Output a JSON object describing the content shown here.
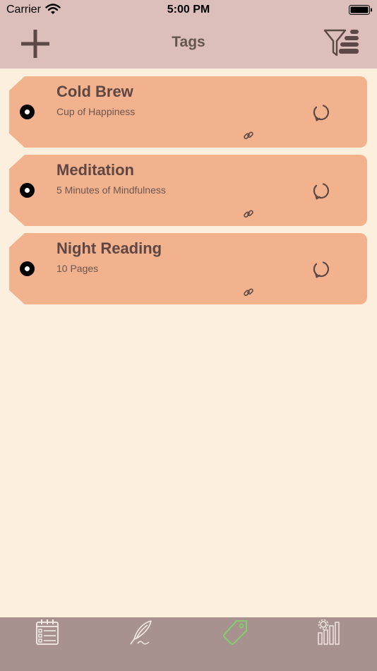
{
  "status_bar": {
    "carrier": "Carrier",
    "time": "5:00 PM",
    "icons": [
      "wifi-icon",
      "battery-icon"
    ]
  },
  "nav": {
    "title": "Tags",
    "left_icon": "plus-icon",
    "right_icon": "filter-sort-icon"
  },
  "tags": [
    {
      "title": "Cold Brew",
      "subtitle": "Cup of Happiness"
    },
    {
      "title": "Meditation",
      "subtitle": "5 Minutes of Mindfulness"
    },
    {
      "title": "Night Reading",
      "subtitle": "10 Pages"
    }
  ],
  "tab_bar": {
    "items": [
      {
        "icon": "planner-icon",
        "active": false
      },
      {
        "icon": "journal-quill-icon",
        "active": false
      },
      {
        "icon": "tag-icon",
        "active": true
      },
      {
        "icon": "settings-stats-icon",
        "active": false
      }
    ]
  },
  "colors": {
    "header_bg": "#dcbfba",
    "page_bg": "#fcefde",
    "card_bg": "#f2b28e",
    "tab_bar_bg": "#a7928f",
    "active_tab": "#7fd46a"
  }
}
